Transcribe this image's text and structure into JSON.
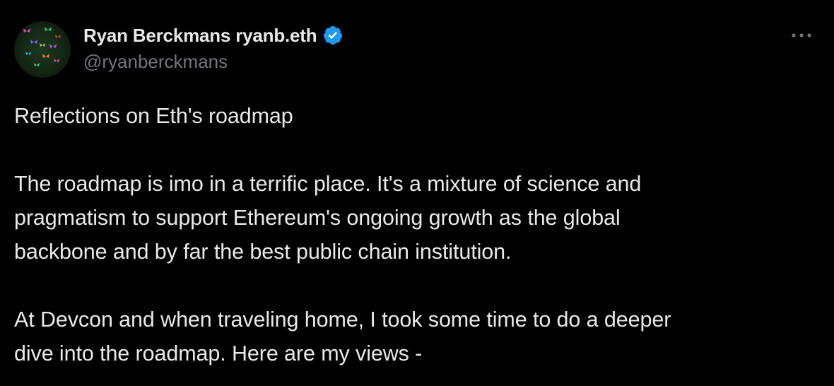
{
  "author": {
    "display_name": "Ryan Berckmans ryanb.eth",
    "handle": "@ryanberckmans",
    "verified": true,
    "avatar": "butterflies-avatar"
  },
  "menu": {
    "icon": "more-icon"
  },
  "tweet": {
    "title": "Reflections on Eth's roadmap",
    "lines_p2": [
      "The roadmap is imo in a terrific place. It's a mixture of science and",
      "pragmatism to support Ethereum's ongoing growth as the global",
      "backbone and by far the best public chain institution."
    ],
    "lines_p3": [
      "At Devcon and when traveling home, I took some time to do a deeper",
      "dive into the roadmap. Here are my views -"
    ]
  },
  "colors": {
    "background": "#000000",
    "text": "#e7e9ea",
    "secondary": "#71767b",
    "verified_blue": "#1d9bf0"
  }
}
